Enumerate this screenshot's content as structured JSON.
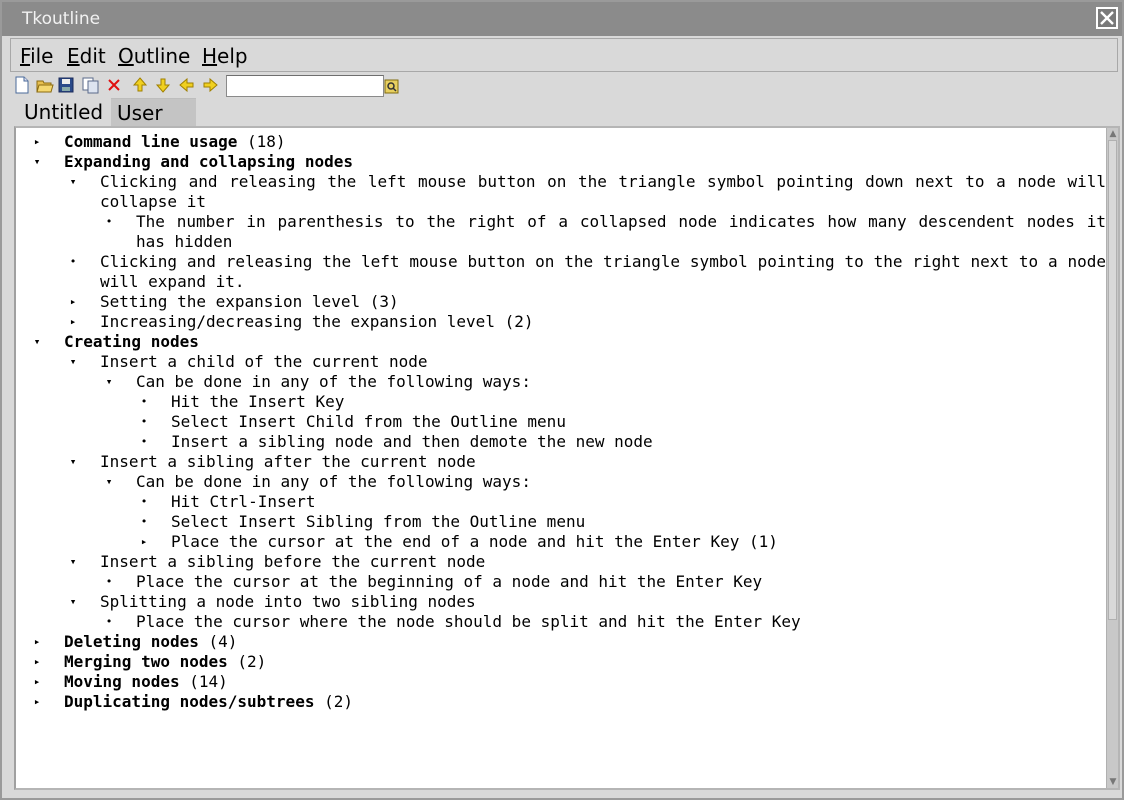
{
  "window": {
    "title": "Tkoutline"
  },
  "menubar": [
    {
      "label": "File"
    },
    {
      "label": "Edit"
    },
    {
      "label": "Outline"
    },
    {
      "label": "Help"
    }
  ],
  "toolbar": {
    "icons": [
      "new-file-icon",
      "open-folder-icon",
      "save-icon",
      "copy-icon",
      "delete-icon",
      "move-up-icon",
      "move-down-icon",
      "move-left-icon",
      "move-right-icon",
      "search-icon"
    ],
    "search_value": ""
  },
  "tabs": [
    {
      "label": "Untitled",
      "active": false
    },
    {
      "label": "User Manual *",
      "active": true
    }
  ],
  "outline": {
    "n1": {
      "label": "Command line usage",
      "count": " (18)"
    },
    "n2": {
      "label": "Expanding and collapsing nodes"
    },
    "n2a": {
      "label": "Clicking and releasing the left mouse button on the triangle symbol pointing down next to a node will collapse it"
    },
    "n2a1": {
      "label": "The number in parenthesis to the right of a collapsed node indicates how many descendent nodes it has hidden"
    },
    "n2b": {
      "label": "Clicking and releasing the left mouse button on the triangle symbol pointing to the right next to a node will expand it."
    },
    "n2c": {
      "label": "Setting the expansion level (3)"
    },
    "n2d": {
      "label": "Increasing/decreasing the expansion level (2)"
    },
    "n3": {
      "label": "Creating nodes"
    },
    "n3a": {
      "label": "Insert a child of the current node"
    },
    "n3a1": {
      "label": "Can be done in any of the following ways:"
    },
    "n3a1a": {
      "label": "Hit the Insert Key"
    },
    "n3a1b": {
      "label": "Select Insert Child from the Outline menu"
    },
    "n3a1c": {
      "label": "Insert a sibling node and then demote the new node"
    },
    "n3b": {
      "label": "Insert a sibling after the current node"
    },
    "n3b1": {
      "label": "Can be done in any of the following ways:"
    },
    "n3b1a": {
      "label": "Hit Ctrl-Insert"
    },
    "n3b1b": {
      "label": "Select Insert Sibling from the Outline menu"
    },
    "n3b1c": {
      "label": "Place the cursor at the end of a node and hit the Enter Key (1)"
    },
    "n3c": {
      "label": "Insert a sibling before the current node"
    },
    "n3c1": {
      "label": "Place the cursor at the beginning of a node and hit the Enter Key"
    },
    "n3d": {
      "label": "Splitting a node into two sibling nodes"
    },
    "n3d1": {
      "label": "Place the cursor where the node should be split and hit the Enter Key"
    },
    "n4": {
      "label": "Deleting nodes",
      "count": " (4)"
    },
    "n5": {
      "label": "Merging two nodes",
      "count": " (2)"
    },
    "n6": {
      "label": "Moving nodes",
      "count": " (14)"
    },
    "n7": {
      "label": "Duplicating nodes/subtrees",
      "count": " (2)"
    }
  },
  "symbols": {
    "collapsed": "▸",
    "expanded": "▾",
    "leaf": "•"
  },
  "colors": {
    "titlebar": "#8b8b8b",
    "window_bg": "#d9d9d9",
    "active_tab": "#c4c4c4"
  }
}
